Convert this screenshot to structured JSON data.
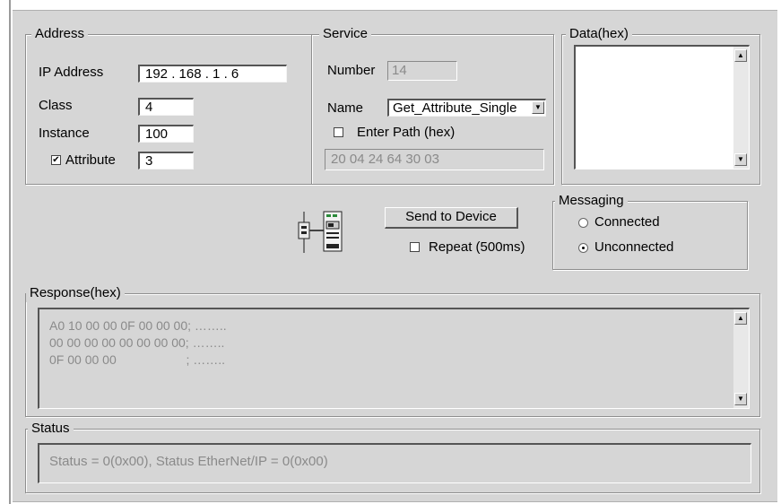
{
  "address": {
    "title": "Address",
    "ip_label": "IP Address",
    "ip_value": "192 . 168 . 1 . 6",
    "class_label": "Class",
    "class_value": "4",
    "instance_label": "Instance",
    "instance_value": "100",
    "attribute_label": "Attribute",
    "attribute_checked": true,
    "attribute_value": "3"
  },
  "service": {
    "title": "Service",
    "number_label": "Number",
    "number_value": "14",
    "name_label": "Name",
    "name_value": "Get_Attribute_Single",
    "enter_path_label": "Enter Path (hex)",
    "enter_path_checked": false,
    "path_value": "20 04 24 64 30 03"
  },
  "data_hex": {
    "title": "Data(hex)",
    "value": ""
  },
  "actions": {
    "send_label": "Send to Device",
    "repeat_label": "Repeat (500ms)",
    "repeat_checked": false
  },
  "messaging": {
    "title": "Messaging",
    "connected_label": "Connected",
    "unconnected_label": "Unconnected",
    "selected": "Unconnected"
  },
  "response": {
    "title": "Response(hex)",
    "lines": [
      "A0 10 00 00 0F 00 00 00; ……..",
      "00 00 00 00 00 00 00 00; ……..",
      "0F 00 00 00                    ; …….."
    ]
  },
  "status": {
    "title": "Status",
    "text": "Status = 0(0x00), Status EtherNet/IP = 0(0x00)"
  },
  "icons": {
    "device": "network-devices-icon",
    "scroll_up": "scroll-up-arrow-icon",
    "scroll_down": "scroll-down-arrow-icon",
    "dropdown": "dropdown-arrow-icon",
    "check": "checkmark-icon"
  },
  "colors": {
    "panel_bg": "#d6d6d6",
    "disabled_text": "#8a8a8a"
  }
}
